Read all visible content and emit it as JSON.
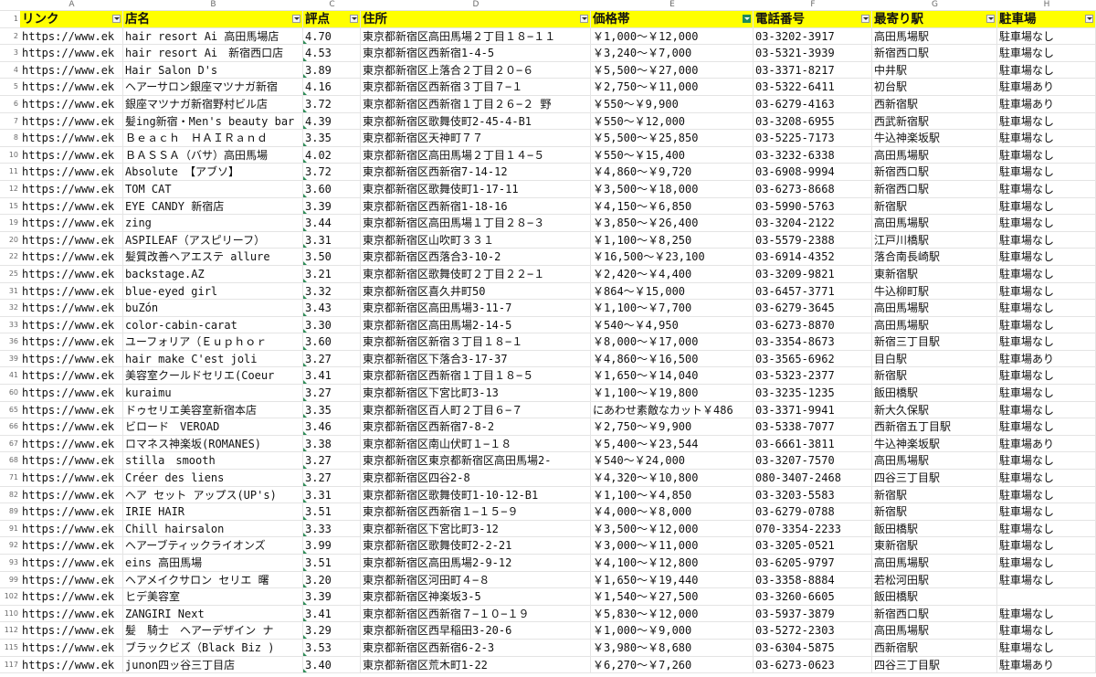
{
  "columns": [
    "A",
    "B",
    "C",
    "D",
    "E",
    "F",
    "G",
    "H"
  ],
  "header_row_num": "1",
  "headers": [
    "リンク",
    "店名",
    "評点",
    "住所",
    "価格帯",
    "電話番号",
    "最寄り駅",
    "駐車場"
  ],
  "rows": [
    {
      "num": "2",
      "link": "https://www.ek",
      "name": "hair resort Ai 高田馬場店",
      "score": "4.70",
      "addr": "東京都新宿区高田馬場２丁目１８−１１",
      "price": "￥1,000～￥12,000",
      "tel": "03-3202-3917",
      "station": "高田馬場駅",
      "parking": "駐車場なし"
    },
    {
      "num": "3",
      "link": "https://www.ek",
      "name": "hair resort Ai　新宿西口店",
      "score": "4.53",
      "addr": "東京都新宿区西新宿1-4-5",
      "price": "￥3,240～￥7,000",
      "tel": "03-5321-3939",
      "station": "新宿西口駅",
      "parking": "駐車場なし"
    },
    {
      "num": "4",
      "link": "https://www.ek",
      "name": "Hair Salon D's",
      "score": "3.89",
      "addr": "東京都新宿区上落合２丁目２０−６",
      "price": "￥5,500～￥27,000",
      "tel": "03-3371-8217",
      "station": "中井駅",
      "parking": "駐車場なし"
    },
    {
      "num": "5",
      "link": "https://www.ek",
      "name": "ヘアーサロン銀座マツナガ新宿",
      "score": "4.16",
      "addr": "東京都新宿区西新宿３丁目７−１",
      "price": "￥2,750～￥11,000",
      "tel": "03-5322-6411",
      "station": "初台駅",
      "parking": "駐車場あり"
    },
    {
      "num": "6",
      "link": "https://www.ek",
      "name": "銀座マツナガ新宿野村ビル店",
      "score": "3.72",
      "addr": "東京都新宿区西新宿１丁目２６−２ 野",
      "price": "￥550～￥9,900",
      "tel": "03-6279-4163",
      "station": "西新宿駅",
      "parking": "駐車場あり"
    },
    {
      "num": "7",
      "link": "https://www.ek",
      "name": "髪ing新宿・Men's beauty bar",
      "score": "4.39",
      "addr": "東京都新宿区歌舞伎町2-45-4-B1",
      "price": "￥550～￥12,000",
      "tel": "03-3208-6955",
      "station": "西武新宿駅",
      "parking": "駐車場なし"
    },
    {
      "num": "8",
      "link": "https://www.ek",
      "name": "Ｂｅａｃｈ　ＨＡＩＲａｎｄ",
      "score": "3.35",
      "addr": "東京都新宿区天神町７７",
      "price": "￥5,500～￥25,850",
      "tel": "03-5225-7173",
      "station": "牛込神楽坂駅",
      "parking": "駐車場なし"
    },
    {
      "num": "10",
      "link": "https://www.ek",
      "name": "ＢＡＳＳＡ（バサ）高田馬場",
      "score": "4.02",
      "addr": "東京都新宿区高田馬場２丁目１４−５",
      "price": "￥550～￥15,400",
      "tel": "03-3232-6338",
      "station": "高田馬場駅",
      "parking": "駐車場なし"
    },
    {
      "num": "11",
      "link": "https://www.ek",
      "name": "Absolute 【アブソ】",
      "score": "3.72",
      "addr": "東京都新宿区西新宿7-14-12",
      "price": "￥4,860～￥9,720",
      "tel": "03-6908-9994",
      "station": "新宿西口駅",
      "parking": "駐車場なし"
    },
    {
      "num": "12",
      "link": "https://www.ek",
      "name": "TOM CAT",
      "score": "3.60",
      "addr": "東京都新宿区歌舞伎町1-17-11",
      "price": "￥3,500～￥18,000",
      "tel": "03-6273-8668",
      "station": "新宿西口駅",
      "parking": "駐車場なし"
    },
    {
      "num": "15",
      "link": "https://www.ek",
      "name": "EYE CANDY 新宿店",
      "score": "3.39",
      "addr": "東京都新宿区西新宿1-18-16",
      "price": "￥4,150～￥6,850",
      "tel": "03-5990-5763",
      "station": "新宿駅",
      "parking": "駐車場なし"
    },
    {
      "num": "19",
      "link": "https://www.ek",
      "name": "zing",
      "score": "3.44",
      "addr": "東京都新宿区高田馬場１丁目２８−３",
      "price": "￥3,850～￥26,400",
      "tel": "03-3204-2122",
      "station": "高田馬場駅",
      "parking": "駐車場なし"
    },
    {
      "num": "20",
      "link": "https://www.ek",
      "name": "ASPILEAF（アスピリーフ）",
      "score": "3.31",
      "addr": "東京都新宿区山吹町３３１",
      "price": "￥1,100～￥8,250",
      "tel": "03-5579-2388",
      "station": "江戸川橋駅",
      "parking": "駐車場なし"
    },
    {
      "num": "22",
      "link": "https://www.ek",
      "name": "髪質改善ヘアエステ allure",
      "score": "3.50",
      "addr": "東京都新宿区西落合3-10-2",
      "price": "￥16,500～￥23,100",
      "tel": "03-6914-4352",
      "station": "落合南長崎駅",
      "parking": "駐車場なし"
    },
    {
      "num": "25",
      "link": "https://www.ek",
      "name": "backstage.AZ",
      "score": "3.21",
      "addr": "東京都新宿区歌舞伎町２丁目２２−１",
      "price": "￥2,420～￥4,400",
      "tel": "03-3209-9821",
      "station": "東新宿駅",
      "parking": "駐車場なし"
    },
    {
      "num": "31",
      "link": "https://www.ek",
      "name": "blue-eyed girl",
      "score": "3.32",
      "addr": "東京都新宿区喜久井町50",
      "price": "￥864～￥15,000",
      "tel": "03-6457-3771",
      "station": "牛込柳町駅",
      "parking": "駐車場なし"
    },
    {
      "num": "32",
      "link": "https://www.ek",
      "name": "buZón",
      "score": "3.43",
      "addr": "東京都新宿区高田馬場3-11-7",
      "price": "￥1,100～￥7,700",
      "tel": "03-6279-3645",
      "station": "高田馬場駅",
      "parking": "駐車場なし"
    },
    {
      "num": "33",
      "link": "https://www.ek",
      "name": "color-cabin-carat",
      "score": "3.30",
      "addr": "東京都新宿区高田馬場2-14-5",
      "price": "￥540～￥4,950",
      "tel": "03-6273-8870",
      "station": "高田馬場駅",
      "parking": "駐車場なし"
    },
    {
      "num": "36",
      "link": "https://www.ek",
      "name": "ユーフォリア（Ｅｕｐｈｏｒ",
      "score": "3.60",
      "addr": "東京都新宿区新宿３丁目１８−１",
      "price": "￥8,000～￥17,000",
      "tel": "03-3354-8673",
      "station": "新宿三丁目駅",
      "parking": "駐車場なし"
    },
    {
      "num": "39",
      "link": "https://www.ek",
      "name": "hair make C'est joli",
      "score": "3.27",
      "addr": "東京都新宿区下落合3-17-37",
      "price": "￥4,860～￥16,500",
      "tel": "03-3565-6962",
      "station": "目白駅",
      "parking": "駐車場あり"
    },
    {
      "num": "41",
      "link": "https://www.ek",
      "name": "美容室クールドセリエ(Coeur",
      "score": "3.41",
      "addr": "東京都新宿区西新宿１丁目１８−５",
      "price": "￥1,650～￥14,040",
      "tel": "03-5323-2377",
      "station": "新宿駅",
      "parking": "駐車場なし"
    },
    {
      "num": "60",
      "link": "https://www.ek",
      "name": "kuraimu",
      "score": "3.27",
      "addr": "東京都新宿区下宮比町3-13",
      "price": "￥1,100～￥19,800",
      "tel": "03-3235-1235",
      "station": "飯田橋駅",
      "parking": "駐車場なし"
    },
    {
      "num": "65",
      "link": "https://www.ek",
      "name": "ドゥセリエ美容室新宿本店",
      "score": "3.35",
      "addr": "東京都新宿区百人町２丁目６−７",
      "price": "にあわせ素敵なカット￥486",
      "tel": "03-3371-9941",
      "station": "新大久保駅",
      "parking": "駐車場なし"
    },
    {
      "num": "66",
      "link": "https://www.ek",
      "name": "ビロード　VEROAD",
      "score": "3.46",
      "addr": "東京都新宿区西新宿7-8-2",
      "price": "￥2,750～￥9,900",
      "tel": "03-5338-7077",
      "station": "西新宿五丁目駅",
      "parking": "駐車場なし"
    },
    {
      "num": "67",
      "link": "https://www.ek",
      "name": "ロマネス神楽坂(ROMANES)",
      "score": "3.38",
      "addr": "東京都新宿区南山伏町１−１８",
      "price": "￥5,400～￥23,544",
      "tel": "03-6661-3811",
      "station": "牛込神楽坂駅",
      "parking": "駐車場あり"
    },
    {
      "num": "68",
      "link": "https://www.ek",
      "name": "stilla　smooth",
      "score": "3.27",
      "addr": "東京都新宿区東京都新宿区高田馬場2-",
      "price": "￥540～￥24,000",
      "tel": "03-3207-7570",
      "station": "高田馬場駅",
      "parking": "駐車場なし"
    },
    {
      "num": "71",
      "link": "https://www.ek",
      "name": "Créer des liens",
      "score": "3.27",
      "addr": "東京都新宿区四谷2-8",
      "price": "￥4,320～￥10,800",
      "tel": "080-3407-2468",
      "station": "四谷三丁目駅",
      "parking": "駐車場なし"
    },
    {
      "num": "82",
      "link": "https://www.ek",
      "name": "ヘア セット アップス(UP's)",
      "score": "3.31",
      "addr": "東京都新宿区歌舞伎町1-10-12-B1",
      "price": "￥1,100～￥4,850",
      "tel": "03-3203-5583",
      "station": "新宿駅",
      "parking": "駐車場なし"
    },
    {
      "num": "89",
      "link": "https://www.ek",
      "name": "IRIE HAIR",
      "score": "3.51",
      "addr": "東京都新宿区西新宿１−１５−９",
      "price": "￥4,000～￥8,000",
      "tel": "03-6279-0788",
      "station": "新宿駅",
      "parking": "駐車場なし"
    },
    {
      "num": "91",
      "link": "https://www.ek",
      "name": "Chill hairsalon",
      "score": "3.33",
      "addr": "東京都新宿区下宮比町3-12",
      "price": "￥3,500～￥12,000",
      "tel": "070-3354-2233",
      "station": "飯田橋駅",
      "parking": "駐車場なし"
    },
    {
      "num": "92",
      "link": "https://www.ek",
      "name": "ヘアーブティックライオンズ",
      "score": "3.99",
      "addr": "東京都新宿区歌舞伎町2-2-21",
      "price": "￥3,000～￥11,000",
      "tel": "03-3205-0521",
      "station": "東新宿駅",
      "parking": "駐車場なし"
    },
    {
      "num": "93",
      "link": "https://www.ek",
      "name": "eins 高田馬場",
      "score": "3.51",
      "addr": "東京都新宿区高田馬場2-9-12",
      "price": "￥4,100～￥12,800",
      "tel": "03-6205-9797",
      "station": "高田馬場駅",
      "parking": "駐車場なし"
    },
    {
      "num": "99",
      "link": "https://www.ek",
      "name": "ヘアメイクサロン セリエ 曙",
      "score": "3.20",
      "addr": "東京都新宿区河田町４−８",
      "price": "￥1,650～￥19,440",
      "tel": "03-3358-8884",
      "station": "若松河田駅",
      "parking": "駐車場なし"
    },
    {
      "num": "102",
      "link": "https://www.ek",
      "name": "ヒデ美容室",
      "score": "3.39",
      "addr": "東京都新宿区神楽坂3-5",
      "price": "￥1,540～￥27,500",
      "tel": "03-3260-6605",
      "station": "飯田橋駅",
      "parking": ""
    },
    {
      "num": "110",
      "link": "https://www.ek",
      "name": "ZANGIRI Next",
      "score": "3.41",
      "addr": "東京都新宿区西新宿７−１０−１９",
      "price": "￥5,830～￥12,000",
      "tel": "03-5937-3879",
      "station": "新宿西口駅",
      "parking": "駐車場なし"
    },
    {
      "num": "112",
      "link": "https://www.ek",
      "name": "髪　騎士　ヘアーデザイン ナ",
      "score": "3.29",
      "addr": "東京都新宿区西早稲田3-20-6",
      "price": "￥1,000～￥9,000",
      "tel": "03-5272-2303",
      "station": "高田馬場駅",
      "parking": "駐車場なし"
    },
    {
      "num": "115",
      "link": "https://www.ek",
      "name": "ブラックビズ（Black Biz )",
      "score": "3.53",
      "addr": "東京都新宿区西新宿6-2-3",
      "price": "￥3,980～￥8,680",
      "tel": "03-6304-5875",
      "station": "西新宿駅",
      "parking": "駐車場なし"
    },
    {
      "num": "117",
      "link": "https://www.ek",
      "name": "junon四ッ谷三丁目店",
      "score": "3.40",
      "addr": "東京都新宿区荒木町1-22",
      "price": "￥6,270～￥7,260",
      "tel": "03-6273-0623",
      "station": "四谷三丁目駅",
      "parking": "駐車場あり"
    }
  ],
  "filter_active_column": "E",
  "header_color": "#ffff00",
  "filter_color": "#1f8a5b"
}
